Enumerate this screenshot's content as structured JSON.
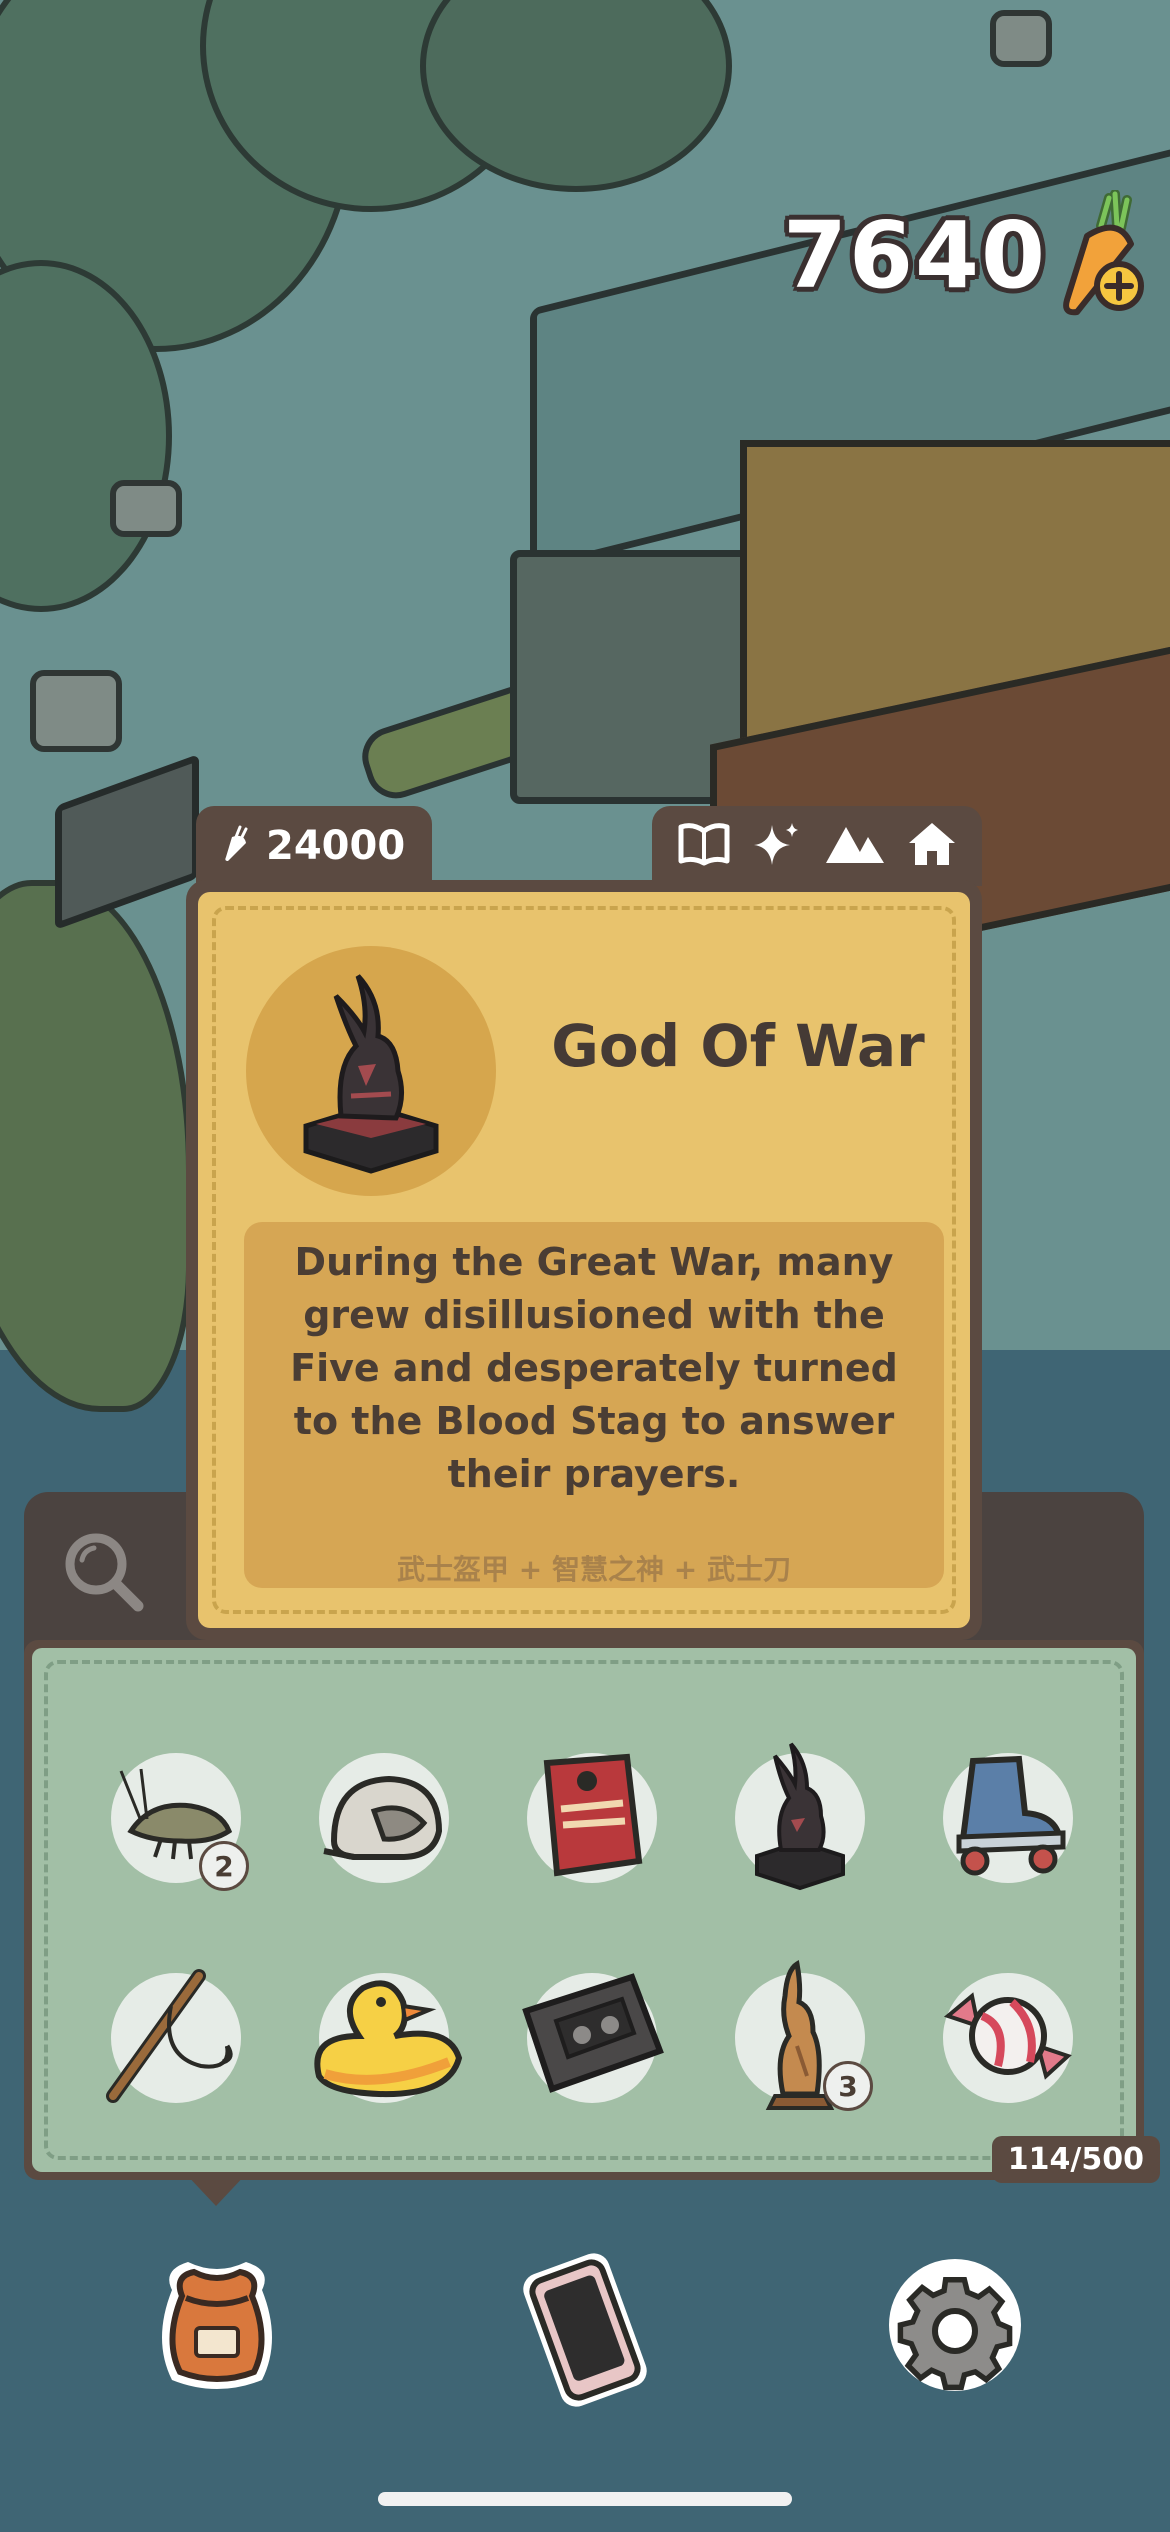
{
  "currency": {
    "amount": "7640",
    "icon": "carrot-plus-icon"
  },
  "item_card": {
    "price": "24000",
    "price_icon": "carrot-icon",
    "tab_icons": [
      "book-icon",
      "sparkle-icon",
      "mountain-icon",
      "house-icon"
    ],
    "title": "God Of War",
    "description": "During the Great War, many grew disillusioned with the Five and desperately turned to the Blood Stag to answer their prayers.",
    "recipe": "武士盔甲 + 智慧之神 + 武士刀"
  },
  "search": {
    "icon": "search-icon"
  },
  "inventory": {
    "count": "114/500",
    "items": [
      {
        "icon": "shrimp-icon",
        "count": "2"
      },
      {
        "icon": "helmet-icon",
        "count": null
      },
      {
        "icon": "night-crawlers-box-icon",
        "count": null
      },
      {
        "icon": "god-of-war-statue-icon",
        "count": null
      },
      {
        "icon": "roller-skate-icon",
        "count": null
      },
      {
        "icon": "fishing-rod-icon",
        "count": null
      },
      {
        "icon": "rubber-duck-icon",
        "count": null
      },
      {
        "icon": "cassette-tape-icon",
        "count": null
      },
      {
        "icon": "wooden-rabbit-statue-icon",
        "count": "3"
      },
      {
        "icon": "candy-icon",
        "count": null
      }
    ]
  },
  "nav": [
    "bag-icon",
    "phone-icon",
    "settings-gear-icon"
  ],
  "colors": {
    "card_bg": "#e8c36d",
    "panel_border": "#5b4a41",
    "inventory_bg": "#a2bfa6"
  }
}
